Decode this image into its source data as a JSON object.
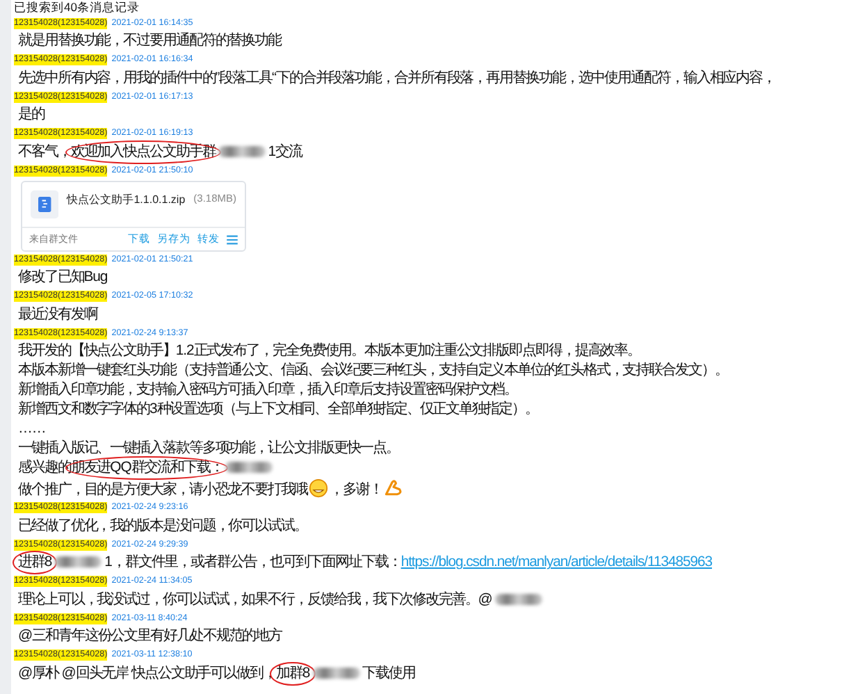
{
  "title": "已搜索到40条消息记录",
  "messages": [
    {
      "sender": "123154028(123154028)",
      "time": "2021-02-01 16:14:35",
      "lines": [
        [
          "就是用替换功能，不过要用通配符的替换功能"
        ]
      ]
    },
    {
      "sender": "123154028(123154028)",
      "time": "2021-02-01 16:16:34",
      "lines": [
        [
          "先选中所有内容，用我的插件中的”段落工具“下的合并段落功能，合并所有段落，再用替换功能，选中使用通配符，输入相应内容，"
        ]
      ]
    },
    {
      "sender": "123154028(123154028)",
      "time": "2021-02-01 16:17:13",
      "lines": [
        [
          "是的"
        ]
      ]
    },
    {
      "sender": "123154028(123154028)",
      "time": "2021-02-01 16:19:13",
      "lines": [
        [
          "不客气，",
          {
            "kind": "circled",
            "text": "欢迎加入快点公文助手群"
          },
          {
            "kind": "redacted"
          },
          "1交流"
        ]
      ]
    },
    {
      "sender": "123154028(123154028)",
      "time": "2021-02-01 21:50:10",
      "file": {
        "name": "快点公文助手1.1.0.1.zip",
        "size": "(3.18MB)",
        "source": "来自群文件",
        "actions": [
          "下载",
          "另存为",
          "转发"
        ]
      }
    },
    {
      "sender": "123154028(123154028)",
      "time": "2021-02-01 21:50:21",
      "lines": [
        [
          "修改了已知Bug"
        ]
      ]
    },
    {
      "sender": "123154028(123154028)",
      "time": "2021-02-05 17:10:32",
      "lines": [
        [
          "最近没有发啊"
        ]
      ]
    },
    {
      "sender": "123154028(123154028)",
      "time": "2021-02-24 9:13:37",
      "lines": [
        [
          "我开发的【快点公文助手】1.2正式发布了，完全免费使用。本版本更加注重公文排版即点即得，提高效率。"
        ],
        [
          "本版本新增一键套红头功能（支持普通公文、信函、会议纪要三种红头，支持自定义本单位的红头格式，支持联合发文）。"
        ],
        [
          "新增插入印章功能，支持输入密码方可插入印章，插入印章后支持设置密码保护文档。"
        ],
        [
          "新增西文和数字字体的3种设置选项（与上下文相同、全部单独指定、仅正文单独指定）。"
        ],
        [
          "……"
        ],
        [
          "一键插入版记、一键插入落款等多项功能，让公文排版更快一点。"
        ],
        [
          "感兴趣的",
          {
            "kind": "circled",
            "text": "朋友进QQ群交流和下载："
          },
          {
            "kind": "redacted"
          }
        ],
        [
          "做个推广，目的是方便大家，请小恐龙不要打我哦",
          {
            "kind": "smiley"
          },
          "，多谢！",
          {
            "kind": "arm"
          }
        ]
      ]
    },
    {
      "sender": "123154028(123154028)",
      "time": "2021-02-24 9:23:16",
      "lines": [
        [
          "已经做了优化，我的版本是没问题，你可以试试。"
        ]
      ]
    },
    {
      "sender": "123154028(123154028)",
      "time": "2021-02-24 9:29:39",
      "lines": [
        [
          {
            "kind": "circled",
            "text": "进群8"
          },
          {
            "kind": "redacted"
          },
          "1，群文件里，或者群公告，也可到下面网址下载：",
          {
            "kind": "link",
            "text": "https://blog.csdn.net/manlyan/article/details/113485963"
          }
        ]
      ]
    },
    {
      "sender": "123154028(123154028)",
      "time": "2021-02-24 11:34:05",
      "lines": [
        [
          "理论上可以，我没试过，你可以试试，如果不行，反馈给我，我下次修改完善。@",
          {
            "kind": "redacted"
          }
        ]
      ]
    },
    {
      "sender": "123154028(123154028)",
      "time": "2021-03-11 8:40:24",
      "lines": [
        [
          "@三和青年这份公文里有好几处不规范的地方"
        ]
      ]
    },
    {
      "sender": "123154028(123154028)",
      "time": "2021-03-11 12:38:10",
      "lines": [
        [
          "@厚朴 @回头无岸 快点公文助手可以做到，",
          {
            "kind": "circled",
            "text": "加群8"
          },
          {
            "kind": "redacted"
          },
          "下载使用"
        ]
      ]
    }
  ]
}
